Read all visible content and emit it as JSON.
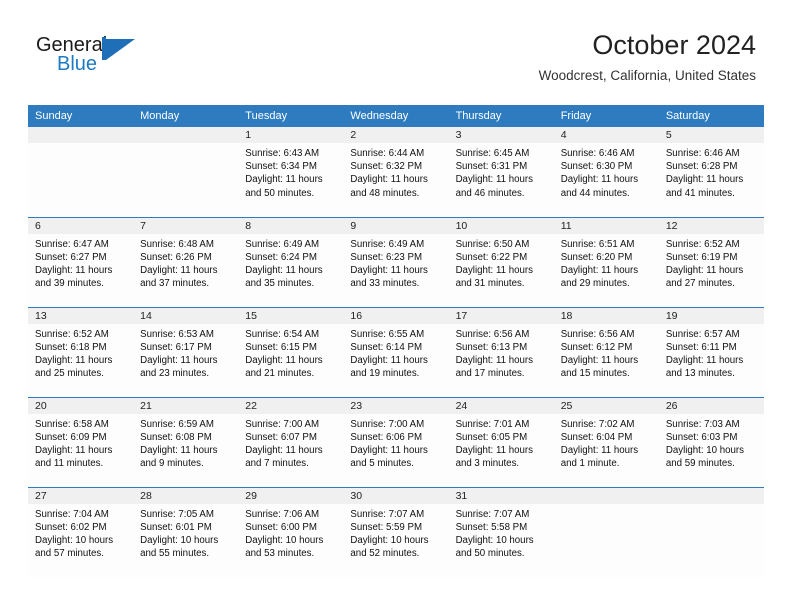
{
  "brand": {
    "name_part1": "General",
    "name_part2": "Blue",
    "logo_icon": "flag-triangle-icon"
  },
  "header": {
    "title": "October 2024",
    "subtitle": "Woodcrest, California, United States"
  },
  "colors": {
    "header_blue": "#2e7cbf",
    "brand_blue": "#1f7ac4",
    "daynum_band": "#f0f0f0",
    "cell_bg": "#fdfdfd"
  },
  "weekday_headers": [
    "Sunday",
    "Monday",
    "Tuesday",
    "Wednesday",
    "Thursday",
    "Friday",
    "Saturday"
  ],
  "weeks": [
    [
      {
        "day": "",
        "empty": true
      },
      {
        "day": "",
        "empty": true
      },
      {
        "day": "1",
        "sunrise": "Sunrise: 6:43 AM",
        "sunset": "Sunset: 6:34 PM",
        "daylight1": "Daylight: 11 hours",
        "daylight2": "and 50 minutes."
      },
      {
        "day": "2",
        "sunrise": "Sunrise: 6:44 AM",
        "sunset": "Sunset: 6:32 PM",
        "daylight1": "Daylight: 11 hours",
        "daylight2": "and 48 minutes."
      },
      {
        "day": "3",
        "sunrise": "Sunrise: 6:45 AM",
        "sunset": "Sunset: 6:31 PM",
        "daylight1": "Daylight: 11 hours",
        "daylight2": "and 46 minutes."
      },
      {
        "day": "4",
        "sunrise": "Sunrise: 6:46 AM",
        "sunset": "Sunset: 6:30 PM",
        "daylight1": "Daylight: 11 hours",
        "daylight2": "and 44 minutes."
      },
      {
        "day": "5",
        "sunrise": "Sunrise: 6:46 AM",
        "sunset": "Sunset: 6:28 PM",
        "daylight1": "Daylight: 11 hours",
        "daylight2": "and 41 minutes."
      }
    ],
    [
      {
        "day": "6",
        "sunrise": "Sunrise: 6:47 AM",
        "sunset": "Sunset: 6:27 PM",
        "daylight1": "Daylight: 11 hours",
        "daylight2": "and 39 minutes."
      },
      {
        "day": "7",
        "sunrise": "Sunrise: 6:48 AM",
        "sunset": "Sunset: 6:26 PM",
        "daylight1": "Daylight: 11 hours",
        "daylight2": "and 37 minutes."
      },
      {
        "day": "8",
        "sunrise": "Sunrise: 6:49 AM",
        "sunset": "Sunset: 6:24 PM",
        "daylight1": "Daylight: 11 hours",
        "daylight2": "and 35 minutes."
      },
      {
        "day": "9",
        "sunrise": "Sunrise: 6:49 AM",
        "sunset": "Sunset: 6:23 PM",
        "daylight1": "Daylight: 11 hours",
        "daylight2": "and 33 minutes."
      },
      {
        "day": "10",
        "sunrise": "Sunrise: 6:50 AM",
        "sunset": "Sunset: 6:22 PM",
        "daylight1": "Daylight: 11 hours",
        "daylight2": "and 31 minutes."
      },
      {
        "day": "11",
        "sunrise": "Sunrise: 6:51 AM",
        "sunset": "Sunset: 6:20 PM",
        "daylight1": "Daylight: 11 hours",
        "daylight2": "and 29 minutes."
      },
      {
        "day": "12",
        "sunrise": "Sunrise: 6:52 AM",
        "sunset": "Sunset: 6:19 PM",
        "daylight1": "Daylight: 11 hours",
        "daylight2": "and 27 minutes."
      }
    ],
    [
      {
        "day": "13",
        "sunrise": "Sunrise: 6:52 AM",
        "sunset": "Sunset: 6:18 PM",
        "daylight1": "Daylight: 11 hours",
        "daylight2": "and 25 minutes."
      },
      {
        "day": "14",
        "sunrise": "Sunrise: 6:53 AM",
        "sunset": "Sunset: 6:17 PM",
        "daylight1": "Daylight: 11 hours",
        "daylight2": "and 23 minutes."
      },
      {
        "day": "15",
        "sunrise": "Sunrise: 6:54 AM",
        "sunset": "Sunset: 6:15 PM",
        "daylight1": "Daylight: 11 hours",
        "daylight2": "and 21 minutes."
      },
      {
        "day": "16",
        "sunrise": "Sunrise: 6:55 AM",
        "sunset": "Sunset: 6:14 PM",
        "daylight1": "Daylight: 11 hours",
        "daylight2": "and 19 minutes."
      },
      {
        "day": "17",
        "sunrise": "Sunrise: 6:56 AM",
        "sunset": "Sunset: 6:13 PM",
        "daylight1": "Daylight: 11 hours",
        "daylight2": "and 17 minutes."
      },
      {
        "day": "18",
        "sunrise": "Sunrise: 6:56 AM",
        "sunset": "Sunset: 6:12 PM",
        "daylight1": "Daylight: 11 hours",
        "daylight2": "and 15 minutes."
      },
      {
        "day": "19",
        "sunrise": "Sunrise: 6:57 AM",
        "sunset": "Sunset: 6:11 PM",
        "daylight1": "Daylight: 11 hours",
        "daylight2": "and 13 minutes."
      }
    ],
    [
      {
        "day": "20",
        "sunrise": "Sunrise: 6:58 AM",
        "sunset": "Sunset: 6:09 PM",
        "daylight1": "Daylight: 11 hours",
        "daylight2": "and 11 minutes."
      },
      {
        "day": "21",
        "sunrise": "Sunrise: 6:59 AM",
        "sunset": "Sunset: 6:08 PM",
        "daylight1": "Daylight: 11 hours",
        "daylight2": "and 9 minutes."
      },
      {
        "day": "22",
        "sunrise": "Sunrise: 7:00 AM",
        "sunset": "Sunset: 6:07 PM",
        "daylight1": "Daylight: 11 hours",
        "daylight2": "and 7 minutes."
      },
      {
        "day": "23",
        "sunrise": "Sunrise: 7:00 AM",
        "sunset": "Sunset: 6:06 PM",
        "daylight1": "Daylight: 11 hours",
        "daylight2": "and 5 minutes."
      },
      {
        "day": "24",
        "sunrise": "Sunrise: 7:01 AM",
        "sunset": "Sunset: 6:05 PM",
        "daylight1": "Daylight: 11 hours",
        "daylight2": "and 3 minutes."
      },
      {
        "day": "25",
        "sunrise": "Sunrise: 7:02 AM",
        "sunset": "Sunset: 6:04 PM",
        "daylight1": "Daylight: 11 hours",
        "daylight2": "and 1 minute."
      },
      {
        "day": "26",
        "sunrise": "Sunrise: 7:03 AM",
        "sunset": "Sunset: 6:03 PM",
        "daylight1": "Daylight: 10 hours",
        "daylight2": "and 59 minutes."
      }
    ],
    [
      {
        "day": "27",
        "sunrise": "Sunrise: 7:04 AM",
        "sunset": "Sunset: 6:02 PM",
        "daylight1": "Daylight: 10 hours",
        "daylight2": "and 57 minutes."
      },
      {
        "day": "28",
        "sunrise": "Sunrise: 7:05 AM",
        "sunset": "Sunset: 6:01 PM",
        "daylight1": "Daylight: 10 hours",
        "daylight2": "and 55 minutes."
      },
      {
        "day": "29",
        "sunrise": "Sunrise: 7:06 AM",
        "sunset": "Sunset: 6:00 PM",
        "daylight1": "Daylight: 10 hours",
        "daylight2": "and 53 minutes."
      },
      {
        "day": "30",
        "sunrise": "Sunrise: 7:07 AM",
        "sunset": "Sunset: 5:59 PM",
        "daylight1": "Daylight: 10 hours",
        "daylight2": "and 52 minutes."
      },
      {
        "day": "31",
        "sunrise": "Sunrise: 7:07 AM",
        "sunset": "Sunset: 5:58 PM",
        "daylight1": "Daylight: 10 hours",
        "daylight2": "and 50 minutes."
      },
      {
        "day": "",
        "empty": true
      },
      {
        "day": "",
        "empty": true
      }
    ]
  ]
}
